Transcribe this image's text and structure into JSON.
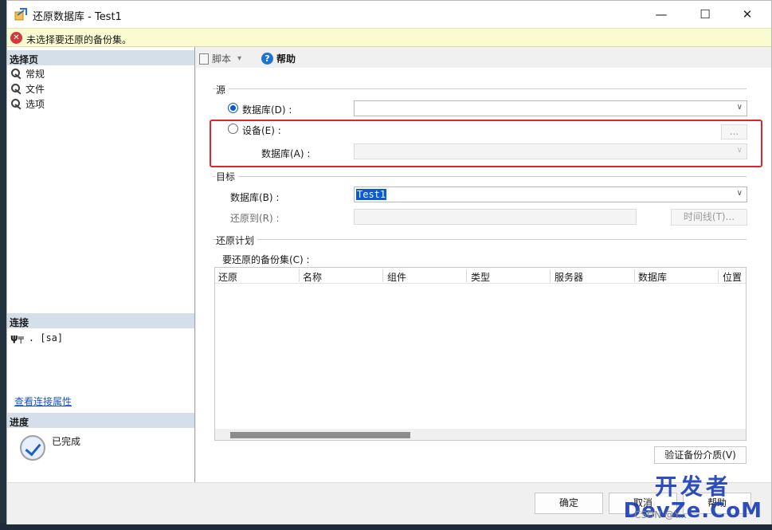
{
  "window": {
    "title": "还原数据库 - Test1",
    "controls": {
      "minimize": "—",
      "maximize": "☐",
      "close": "✕"
    }
  },
  "error_bar": {
    "icon": "error-icon",
    "text": "未选择要还原的备份集。"
  },
  "left_panel": {
    "select_page_header": "选择页",
    "pages": [
      {
        "label": "常规",
        "icon": "wrench-icon"
      },
      {
        "label": "文件",
        "icon": "wrench-icon"
      },
      {
        "label": "选项",
        "icon": "wrench-icon"
      }
    ],
    "connection_header": "连接",
    "connection_value": ". [sa]",
    "connection_link": "查看连接属性",
    "progress_header": "进度",
    "progress_status": "已完成"
  },
  "toolbar": {
    "script_label": "脚本",
    "script_dropdown_arrow": "▾",
    "help_label": "帮助"
  },
  "source": {
    "group_label": "源",
    "database_radio_label": "数据库(D) :",
    "database_value": "",
    "device_radio_label": "设备(E) :",
    "device_browse_label": "...",
    "device_database_label": "数据库(A) :",
    "device_database_value": "",
    "selected_option": "database"
  },
  "target": {
    "group_label": "目标",
    "database_label": "数据库(B) :",
    "database_value": "Test1",
    "restore_to_label": "还原到(R) :",
    "restore_to_value": "",
    "timeline_button": "时间线(T)..."
  },
  "restore_plan": {
    "group_label": "还原计划",
    "backup_sets_label": "要还原的备份集(C) :",
    "columns": [
      "还原",
      "名称",
      "组件",
      "类型",
      "服务器",
      "数据库",
      "位置"
    ],
    "rows": [],
    "verify_button": "验证备份介质(V)"
  },
  "footer": {
    "ok_button": "确定",
    "cancel_button": "取消",
    "help_button": "帮助"
  },
  "watermark": {
    "line1": "开发者",
    "line2": "DevZe.CoM",
    "csdn": "CSDN @Y..."
  },
  "colors": {
    "accent": "#0b5ad1",
    "error": "#d6383a",
    "highlight_box": "#e0262a",
    "link": "#1b54c8"
  }
}
